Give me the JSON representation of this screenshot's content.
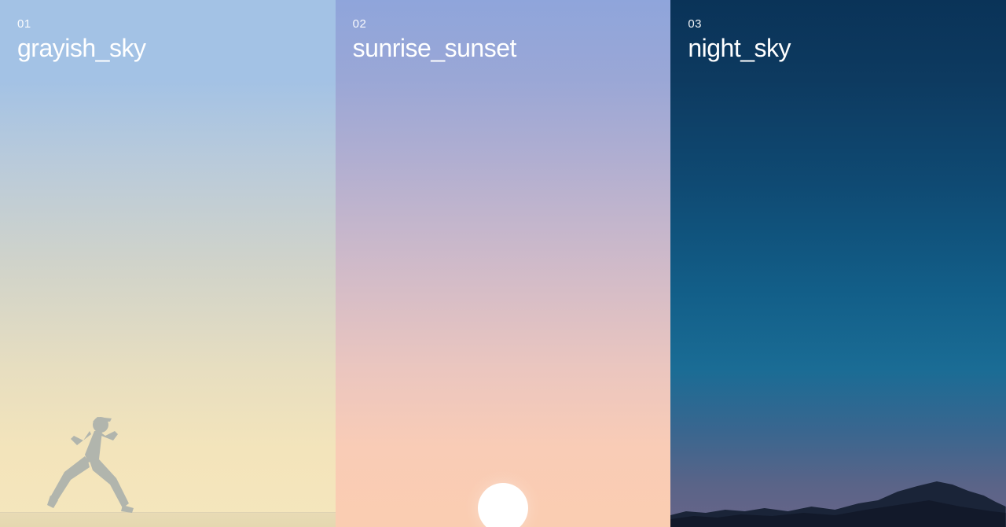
{
  "panels": [
    {
      "number": "01",
      "title": "grayish_sky",
      "gradient_top": "#a3c2e5",
      "gradient_bottom": "#f5e6bc",
      "feature": "runner"
    },
    {
      "number": "02",
      "title": "sunrise_sunset",
      "gradient_top": "#8fa5db",
      "gradient_bottom": "#facdb1",
      "feature": "sun"
    },
    {
      "number": "03",
      "title": "night_sky",
      "gradient_top": "#0a3358",
      "gradient_bottom": "#686589",
      "feature": "mountains"
    }
  ]
}
